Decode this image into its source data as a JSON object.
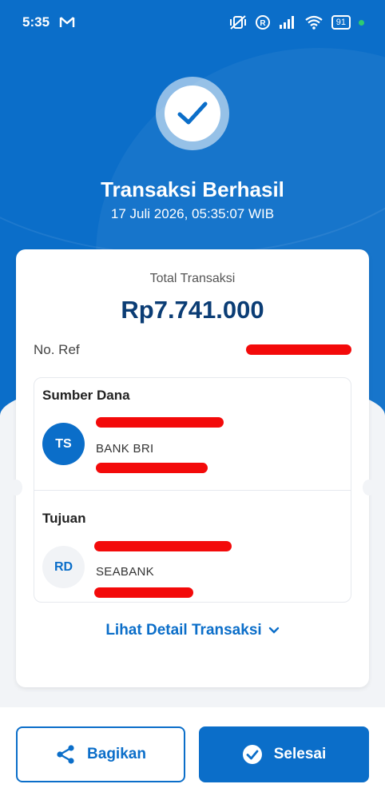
{
  "status_bar": {
    "time": "5:35",
    "battery": "91"
  },
  "result": {
    "title": "Transaksi Berhasil",
    "datetime": "17 Juli 2026, 05:35:07 WIB"
  },
  "summary": {
    "total_label": "Total Transaksi",
    "total_amount": "Rp7.741.000",
    "ref_label": "No. Ref"
  },
  "source": {
    "title": "Sumber Dana",
    "initials": "TS",
    "bank": "BANK BRI"
  },
  "destination": {
    "title": "Tujuan",
    "initials": "RD",
    "bank": "SEABANK"
  },
  "detail_link": "Lihat Detail Transaksi",
  "actions": {
    "share_label": "Bagikan",
    "done_label": "Selesai"
  },
  "colors": {
    "primary": "#0b6ec9",
    "amount": "#0b3d75",
    "redaction": "#f30a0a"
  }
}
